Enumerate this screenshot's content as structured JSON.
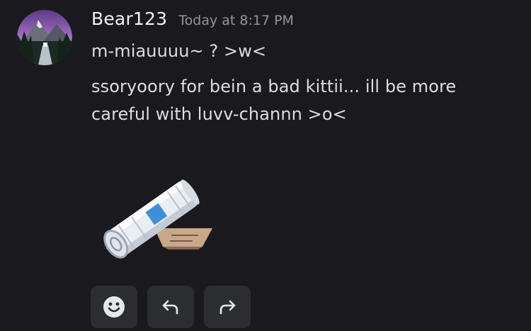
{
  "message": {
    "username": "Bear123",
    "timestamp": "Today at 8:17 PM",
    "lines": [
      "m-miauuuu~ ? >w<",
      "ssoryoory for bein a bad kittii... ill be more",
      "careful with luvv-channn >o<"
    ],
    "sticker": "rolled-newspaper-sticker"
  },
  "actions": {
    "icons": [
      "smiley-icon",
      "reply-icon",
      "forward-icon"
    ]
  },
  "colors": {
    "background": "#1a1a1e",
    "username": "#f2f3f5",
    "timestamp": "#94959c",
    "text": "#dbdee1",
    "button": "#2b2d31"
  }
}
